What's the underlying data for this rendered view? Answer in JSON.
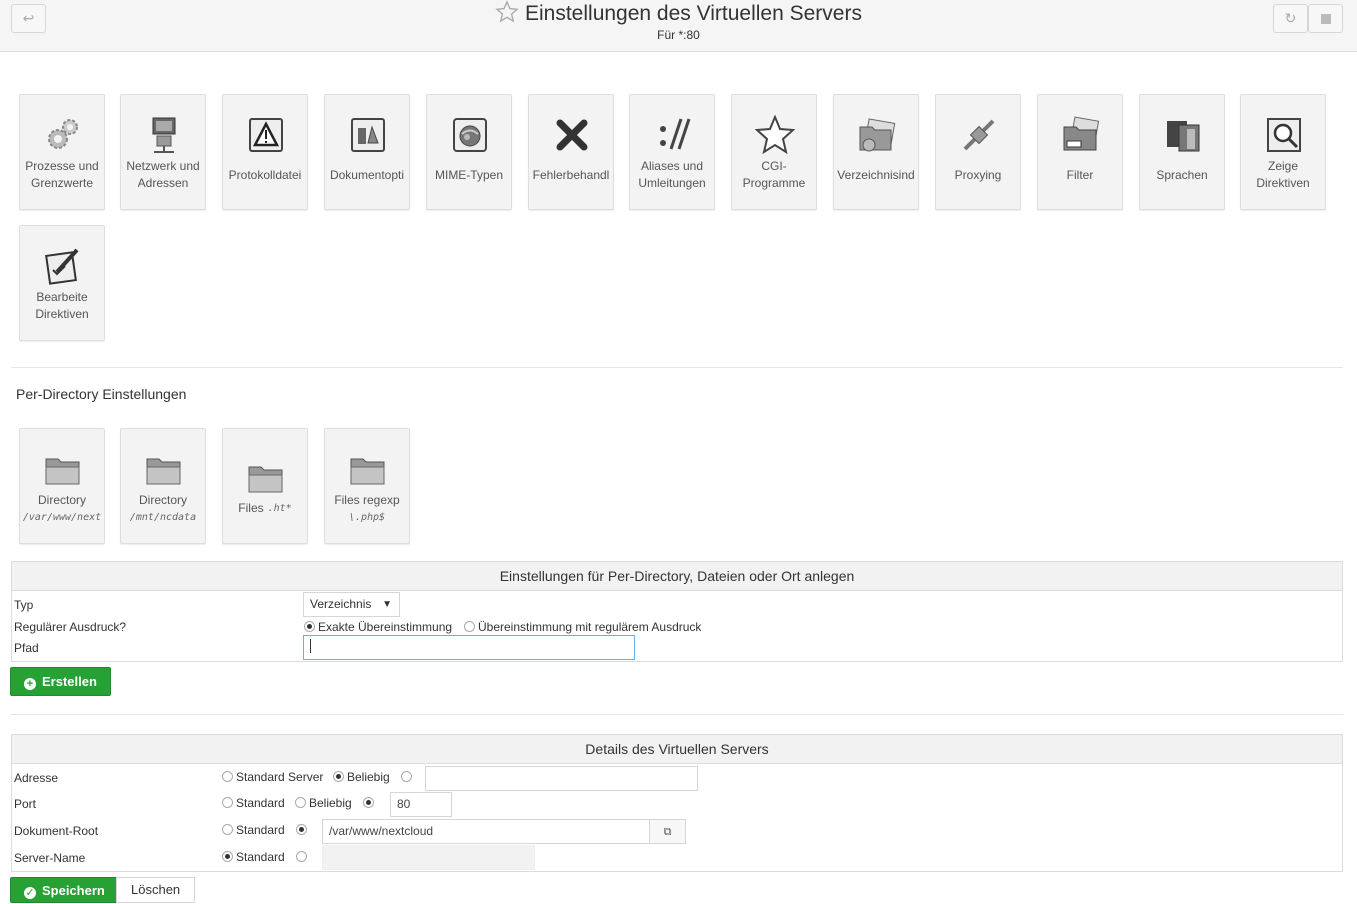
{
  "header": {
    "title": "Einstellungen des Virtuellen Servers",
    "subtitle": "Für *:80"
  },
  "modules": [
    {
      "line1": "Prozesse und",
      "line2": "Grenzwerte",
      "icon": "gears-icon"
    },
    {
      "line1": "Netzwerk und",
      "line2": "Adressen",
      "icon": "network-icon"
    },
    {
      "line1": "Protokolldatei",
      "line2": "",
      "icon": "warning-icon"
    },
    {
      "line1": "Dokumentopti",
      "line2": "",
      "icon": "document-options-icon"
    },
    {
      "line1": "MIME-Typen",
      "line2": "",
      "icon": "mime-icon"
    },
    {
      "line1": "Fehlerbehandl",
      "line2": "",
      "icon": "error-x-icon"
    },
    {
      "line1": "Aliases und",
      "line2": "Umleitungen",
      "icon": "alias-icon"
    },
    {
      "line1": "CGI-",
      "line2": "Programme",
      "icon": "star-icon"
    },
    {
      "line1": "Verzeichnisind",
      "line2": "",
      "icon": "directory-index-icon"
    },
    {
      "line1": "Proxying",
      "line2": "",
      "icon": "proxy-icon"
    },
    {
      "line1": "Filter",
      "line2": "",
      "icon": "filter-icon"
    },
    {
      "line1": "Sprachen",
      "line2": "",
      "icon": "languages-icon"
    },
    {
      "line1": "Zeige",
      "line2": "Direktiven",
      "icon": "show-directives-icon"
    },
    {
      "line1": "Bearbeite",
      "line2": "Direktiven",
      "icon": "edit-directives-icon"
    }
  ],
  "per_directory": {
    "title": "Per-Directory Einstellungen",
    "items": [
      {
        "line1": "Directory",
        "line2": "/var/www/next"
      },
      {
        "line1": "Directory",
        "line2": "/mnt/ncdata"
      },
      {
        "line1": "Files",
        "line2": ".ht*"
      },
      {
        "line1": "Files regexp",
        "line2": "\\.php$"
      }
    ]
  },
  "create_form": {
    "title": "Einstellungen für Per-Directory, Dateien oder Ort anlegen",
    "typ_label": "Typ",
    "typ_value": "Verzeichnis",
    "regex_label": "Regulärer Ausdruck?",
    "regex_opt1": "Exakte Übereinstimmung",
    "regex_opt2": "Übereinstimmung mit regulärem Ausdruck",
    "pfad_label": "Pfad",
    "pfad_value": "",
    "create_button": "Erstellen"
  },
  "details_form": {
    "title": "Details des Virtuellen Servers",
    "adresse_label": "Adresse",
    "adresse_opt1": "Standard Server",
    "adresse_opt2": "Beliebig",
    "adresse_value": "",
    "port_label": "Port",
    "port_opt1": "Standard",
    "port_opt2": "Beliebig",
    "port_value": "80",
    "docroot_label": "Dokument-Root",
    "docroot_opt1": "Standard",
    "docroot_value": "/var/www/nextcloud",
    "servername_label": "Server-Name",
    "servername_opt1": "Standard",
    "servername_value": "",
    "save_button": "Speichern",
    "delete_button": "Löschen"
  },
  "colors": {
    "accent_green": "#27a034",
    "focus_blue": "#66afe9"
  }
}
